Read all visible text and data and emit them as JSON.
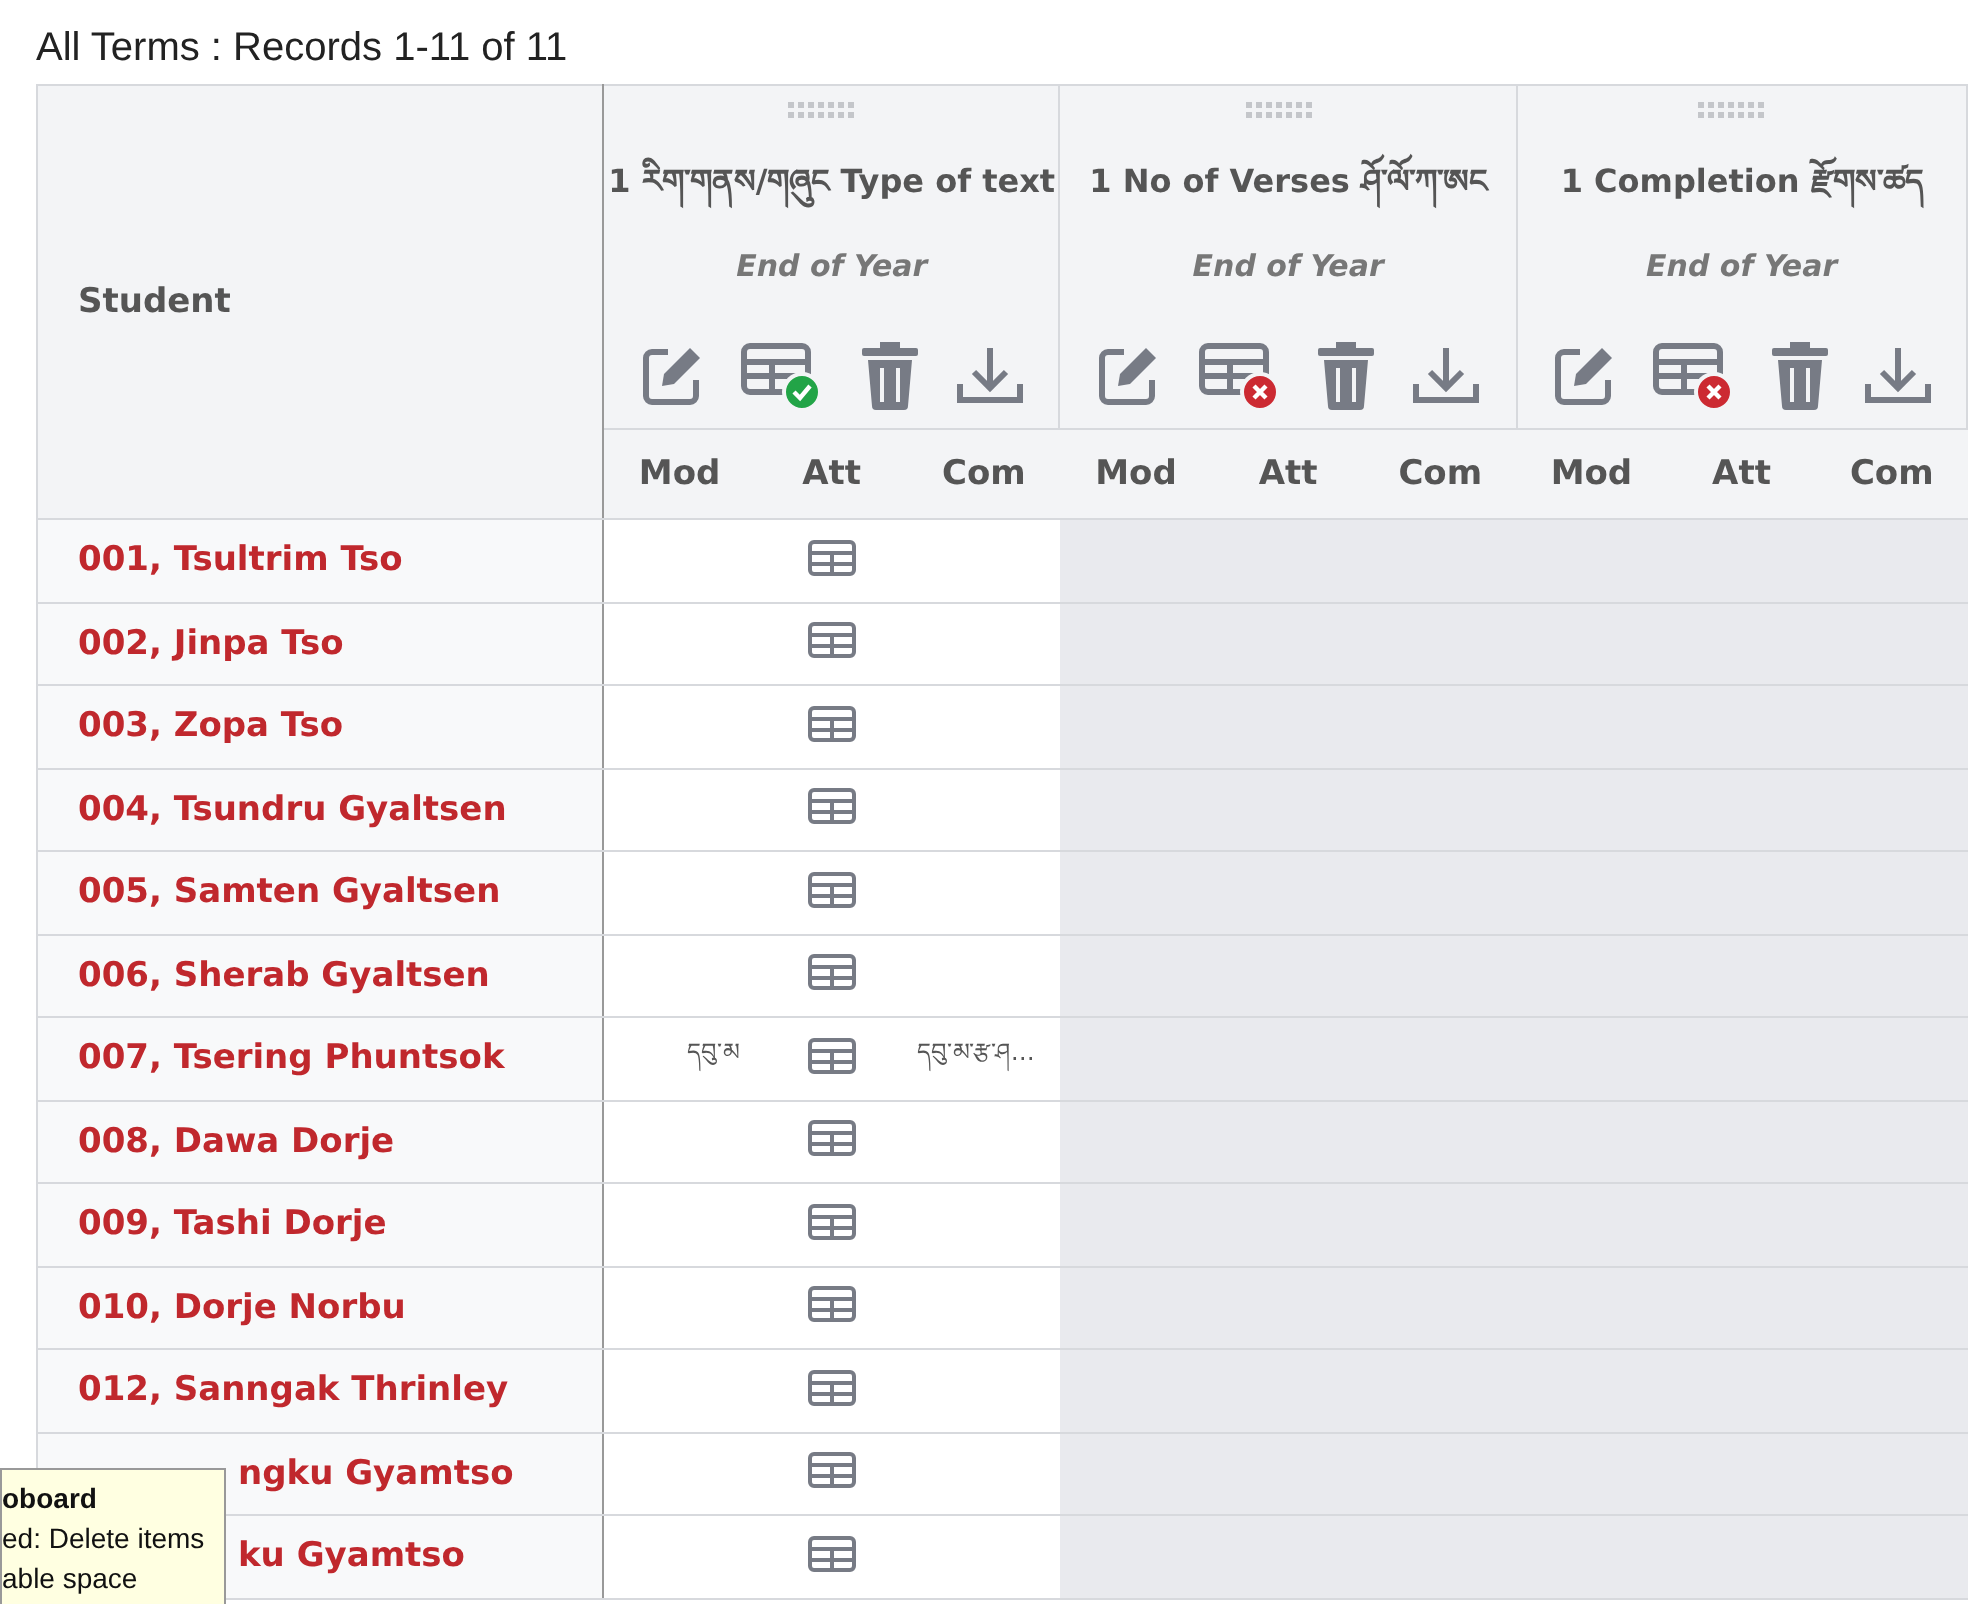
{
  "title": "All Terms : Records 1-11 of 11",
  "student_header": "Student",
  "groups": [
    {
      "title": "1 རིག་གནས/གཞུང Type of text",
      "term": "End of Year",
      "attendance_complete": true,
      "shaded": false,
      "subcolumns": [
        "Mod",
        "Att",
        "Com"
      ]
    },
    {
      "title": "1 No of Verses ཤོ་ལོ་ཀ་ཨང",
      "term": "End of Year",
      "attendance_complete": false,
      "shaded": true,
      "subcolumns": [
        "Mod",
        "Att",
        "Com"
      ]
    },
    {
      "title": "1 Completion རྫོགས་ཚད",
      "term": "End of Year",
      "attendance_complete": false,
      "shaded": true,
      "subcolumns": [
        "Mod",
        "Att",
        "Com"
      ]
    }
  ],
  "rows": [
    {
      "name": "001, Tsultrim Tso",
      "clipped": false
    },
    {
      "name": "002, Jinpa Tso",
      "clipped": false
    },
    {
      "name": "003, Zopa Tso",
      "clipped": false
    },
    {
      "name": "004, Tsundru Gyaltsen",
      "clipped": false
    },
    {
      "name": "005, Samten Gyaltsen",
      "clipped": false
    },
    {
      "name": "006, Sherab Gyaltsen",
      "clipped": false
    },
    {
      "name": "007, Tsering Phuntsok",
      "clipped": false,
      "mod": "དབུ་མ",
      "com": "དབུ་མ་རྩ་ཤ…"
    },
    {
      "name": "008, Dawa Dorje",
      "clipped": false
    },
    {
      "name": "009, Tashi Dorje",
      "clipped": false
    },
    {
      "name": "010, Dorje Norbu",
      "clipped": false
    },
    {
      "name": "012, Sanngak Thrinley",
      "clipped": false
    },
    {
      "name": "ngku Gyamtso",
      "clipped": true
    },
    {
      "name": "ku Gyamtso",
      "clipped": true
    }
  ],
  "tooltip": {
    "title": "oboard",
    "lines": [
      "ed: Delete items",
      "able space"
    ]
  }
}
